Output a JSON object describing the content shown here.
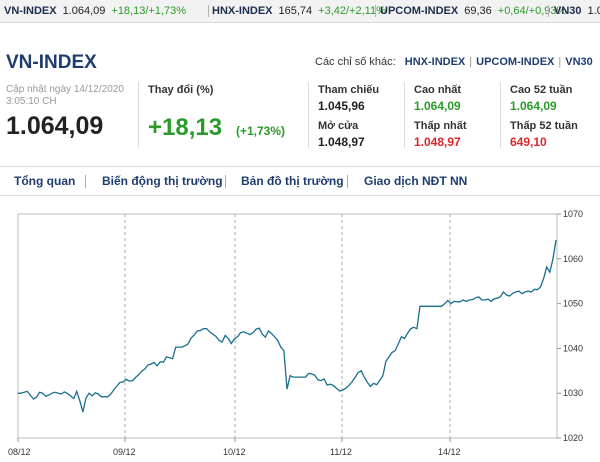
{
  "ticker": [
    {
      "name": "VN-INDEX",
      "value": "1.064,09",
      "change": "+18,13/+1,73%"
    },
    {
      "name": "HNX-INDEX",
      "value": "165,74",
      "change": "+3,42/+2,11%"
    },
    {
      "name": "UPCOM-INDEX",
      "value": "69,36",
      "change": "+0,64/+0,93%"
    },
    {
      "name": "VN30",
      "value": "1.0",
      "change": ""
    }
  ],
  "header": {
    "title": "VN-INDEX",
    "others_label": "Các chỉ số khác:",
    "others": [
      "HNX-INDEX",
      "UPCOM-INDEX",
      "VN30"
    ],
    "separator": "|"
  },
  "summary": {
    "updated_line1": "Cập nhật ngày 14/12/2020",
    "updated_line2": "3:05:10 CH",
    "price": "1.064,09",
    "change_label": "Thay đổi (%)",
    "change_value": "+18,13",
    "change_pct": "(+1,73%)"
  },
  "stats": [
    {
      "label": "Tham chiếu",
      "value": "1.045,96",
      "color": "#222222"
    },
    {
      "label": "Cao nhất",
      "value": "1.064,09",
      "color": "#2a9b2a"
    },
    {
      "label": "Cao 52 tuần",
      "value": "1.064,09",
      "color": "#2a9b2a"
    },
    {
      "label": "Mở cửa",
      "value": "1.048,97",
      "color": "#222222"
    },
    {
      "label": "Thấp nhất",
      "value": "1.048,97",
      "color": "#d9262b"
    },
    {
      "label": "Thấp 52 tuần",
      "value": "649,10",
      "color": "#d9262b"
    }
  ],
  "tabs": [
    "Tổng quan",
    "Biến động thị trường",
    "Bản đồ thị trường",
    "Giao dịch NĐT NN"
  ],
  "colors": {
    "line": "#1a6f8f",
    "up": "#2a9b2a",
    "down": "#d9262b",
    "brand": "#1e3d6e"
  },
  "chart_data": {
    "type": "line",
    "x_ticks": [
      "08/12",
      "09/12",
      "10/12",
      "11/12",
      "14/12"
    ],
    "y_ticks": [
      1020,
      1030,
      1040,
      1050,
      1060,
      1070
    ],
    "ylim": [
      1020,
      1070
    ],
    "grid": "vertical dashed at day boundaries",
    "series": [
      {
        "values": [
          1030.0,
          1030.0,
          1030.2,
          1030.4,
          1029.5,
          1028.7,
          1029.1,
          1030.2,
          1030.0,
          1029.3,
          1029.6,
          1030.0,
          1030.2,
          1030.0,
          1029.8,
          1030.3,
          1029.9,
          1029.4,
          1028.8,
          1030.4,
          1028.3,
          1025.8,
          1028.9,
          1030.0,
          1029.4,
          1030.1,
          1029.8,
          1029.2,
          1029.2,
          1029.2,
          1029.8,
          1030.8,
          1031.6,
          1032.4,
          1032.5,
          1033.1,
          1032.7,
          1032.8,
          1033.5,
          1034.1,
          1034.9,
          1035.4,
          1036.3,
          1036.5,
          1036.9,
          1036.1,
          1037.0,
          1036.9,
          1038.1,
          1037.9,
          1037.7,
          1040.3,
          1040.3,
          1040.3,
          1040.6,
          1041.0,
          1042.3,
          1043.0,
          1043.9,
          1044.0,
          1044.4,
          1044.4,
          1043.7,
          1043.2,
          1042.7,
          1041.8,
          1041.4,
          1042.9,
          1042.2,
          1041.1,
          1042.1,
          1042.6,
          1043.5,
          1043.7,
          1043.4,
          1043.1,
          1043.5,
          1044.3,
          1044.5,
          1043.2,
          1042.5,
          1043.9,
          1043.3,
          1042.6,
          1041.8,
          1040.3,
          1039.5,
          1030.9,
          1033.9,
          1033.6,
          1033.6,
          1033.6,
          1033.6,
          1033.6,
          1034.4,
          1034.3,
          1034.0,
          1033.0,
          1032.8,
          1033.2,
          1031.8,
          1032.0,
          1031.7,
          1031.1,
          1030.5,
          1030.7,
          1031.1,
          1031.7,
          1032.5,
          1033.5,
          1034.6,
          1035.0,
          1033.6,
          1032.4,
          1031.5,
          1032.2,
          1031.9,
          1032.9,
          1033.9,
          1037.1,
          1038.1,
          1039.1,
          1039.5,
          1041.0,
          1042.6,
          1042.2,
          1043.4,
          1044.4,
          1044.7,
          1044.4,
          1049.4,
          1049.4,
          1049.4,
          1049.4,
          1049.4,
          1049.4,
          1049.4,
          1049.4,
          1050.0,
          1050.7,
          1050.0,
          1050.5,
          1050.4,
          1050.4,
          1050.8,
          1050.5,
          1050.8,
          1050.9,
          1051.3,
          1051.5,
          1050.8,
          1050.8,
          1051.0,
          1050.5,
          1051.1,
          1051.2,
          1051.5,
          1052.6,
          1051.9,
          1051.7,
          1052.3,
          1052.6,
          1052.8,
          1052.2,
          1052.6,
          1052.8,
          1052.6,
          1053.2,
          1053.1,
          1053.7,
          1055.6,
          1058.2,
          1057.0,
          1059.9,
          1064.2
        ]
      }
    ]
  }
}
